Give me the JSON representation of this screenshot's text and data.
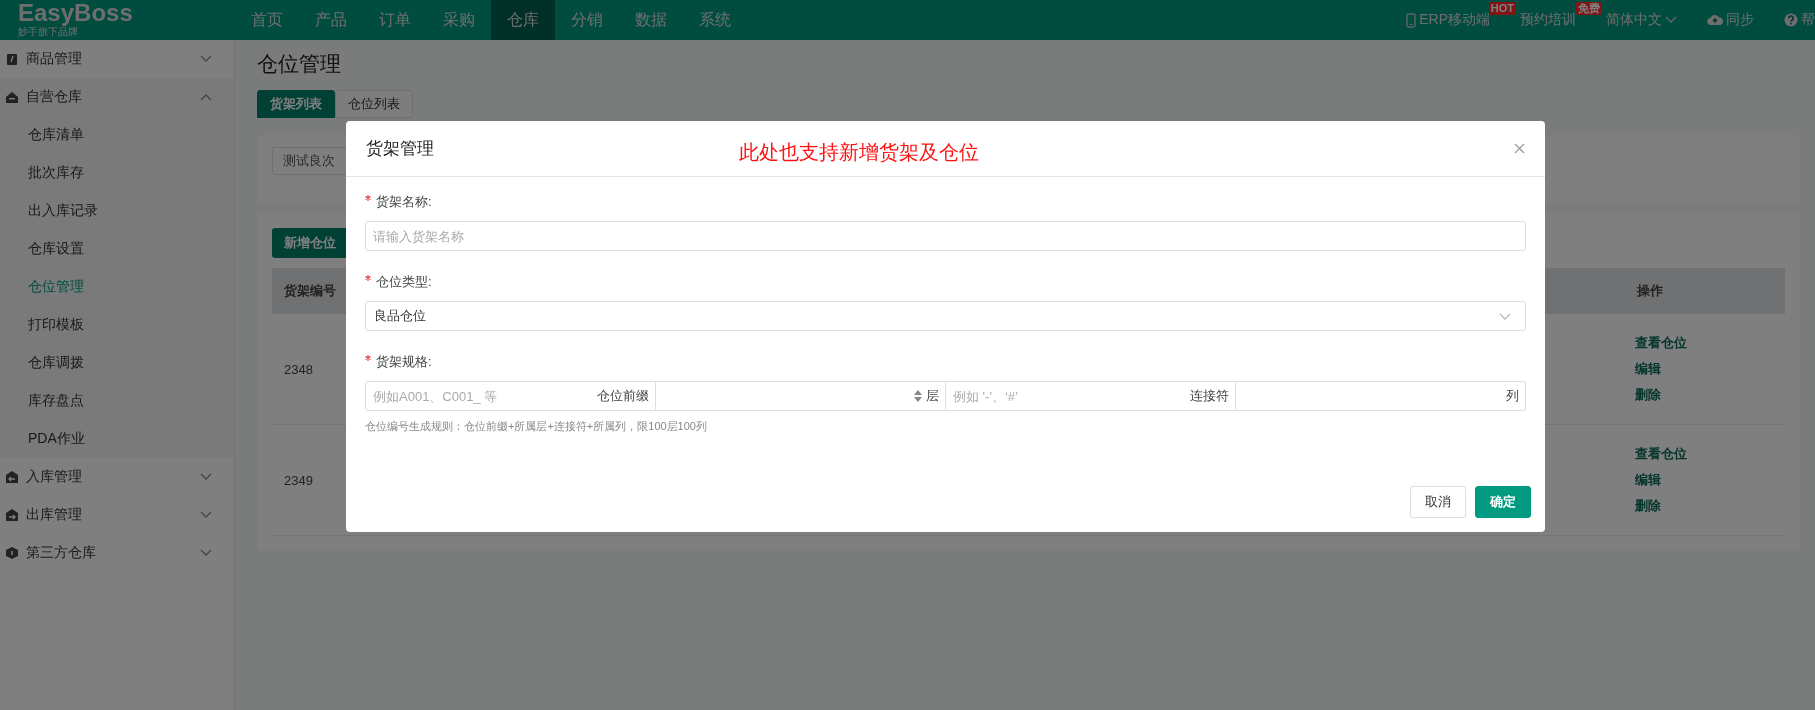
{
  "header": {
    "logo": "EasyBoss",
    "tagline": "妙手旗下品牌",
    "nav": [
      {
        "label": "首页",
        "selected": false
      },
      {
        "label": "产品",
        "selected": false
      },
      {
        "label": "订单",
        "selected": false
      },
      {
        "label": "采购",
        "selected": false
      },
      {
        "label": "仓库",
        "selected": true
      },
      {
        "label": "分销",
        "selected": false
      },
      {
        "label": "数据",
        "selected": false
      },
      {
        "label": "系统",
        "selected": false
      }
    ],
    "tools": [
      {
        "kind": "phone",
        "label": "ERP移动端",
        "badge": "HOT"
      },
      {
        "kind": "plain",
        "label": "预约培训",
        "badge": "免费"
      },
      {
        "kind": "dropdown",
        "label": "简体中文"
      },
      {
        "kind": "cloud",
        "label": "同步"
      },
      {
        "kind": "help",
        "label": "帮"
      }
    ]
  },
  "sidebar": {
    "groups": [
      {
        "kind": "clipboard",
        "label": "商品管理",
        "expanded": false
      },
      {
        "kind": "house",
        "label": "自营仓库",
        "expanded": true,
        "items": [
          {
            "label": "仓库清单",
            "selected": false
          },
          {
            "label": "批次库存",
            "selected": false
          },
          {
            "label": "出入库记录",
            "selected": false
          },
          {
            "label": "仓库设置",
            "selected": false
          },
          {
            "label": "仓位管理",
            "selected": true
          },
          {
            "label": "打印模板",
            "selected": false
          },
          {
            "label": "仓库调拨",
            "selected": false
          },
          {
            "label": "库存盘点",
            "selected": false
          },
          {
            "label": "PDA作业",
            "selected": false
          }
        ]
      },
      {
        "kind": "box-in",
        "label": "入库管理",
        "expanded": false
      },
      {
        "kind": "box-out",
        "label": "出库管理",
        "expanded": false
      },
      {
        "kind": "cube",
        "label": "第三方仓库",
        "expanded": false
      }
    ]
  },
  "page": {
    "title": "仓位管理",
    "tabs": [
      {
        "label": "货架列表",
        "selected": true
      },
      {
        "label": "仓位列表",
        "selected": false
      }
    ],
    "filter": {
      "value": "测试良次"
    },
    "add_button": "新增仓位",
    "table": {
      "columns": [
        "货架编号",
        "操作"
      ],
      "rows": [
        {
          "cells": [
            "2348"
          ],
          "actions": [
            "查看仓位",
            "编辑",
            "删除"
          ]
        },
        {
          "cells": [
            "2349"
          ],
          "actions": [
            "查看仓位",
            "编辑",
            "删除"
          ]
        }
      ]
    }
  },
  "dialog": {
    "title": "货架管理",
    "annotation": "此处也支持新增货架及仓位",
    "fields": [
      {
        "kind": "text",
        "label": "货架名称:",
        "required": true,
        "placeholder": "请输入货架名称"
      },
      {
        "kind": "select",
        "label": "仓位类型:",
        "required": true,
        "value": "良品仓位"
      },
      {
        "kind": "spec",
        "label": "货架规格:",
        "required": true,
        "parts": [
          {
            "kind": "text",
            "placeholder": "例如A001、C001_ 等",
            "suffix": "仓位前缀"
          },
          {
            "kind": "number",
            "suffix": "层"
          },
          {
            "kind": "text",
            "placeholder": "例如 '-'、‘#’",
            "suffix": "连接符"
          },
          {
            "kind": "text",
            "suffix": "列"
          }
        ],
        "hint": "仓位编号生成规则：仓位前缀+所属层+连接符+所属列，限100层100列"
      }
    ],
    "buttons": [
      {
        "kind": "default",
        "label": "取消"
      },
      {
        "kind": "primary",
        "label": "确定"
      }
    ]
  }
}
